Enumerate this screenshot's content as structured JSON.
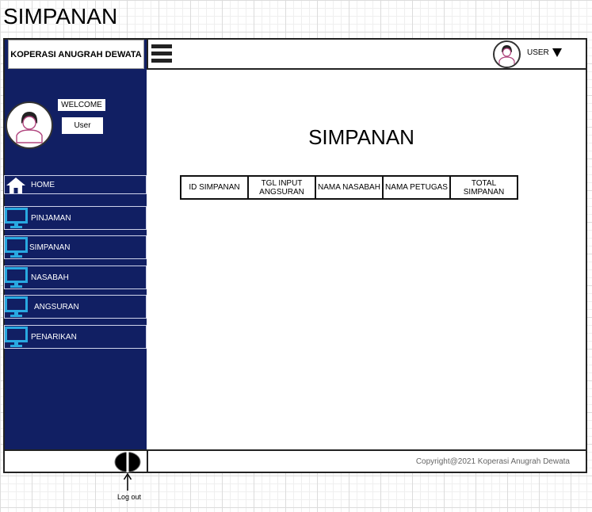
{
  "page": {
    "heading": "SIMPANAN"
  },
  "brand": {
    "name": "KOPERASI ANUGRAH DEWATA"
  },
  "topbar": {
    "user_label": "USER"
  },
  "sidebar": {
    "welcome": "WELCOME",
    "user": "User",
    "items": [
      {
        "label": "HOME",
        "icon": "home-icon"
      },
      {
        "label": "PINJAMAN",
        "icon": "monitor-icon"
      },
      {
        "label": "SIMPANAN",
        "icon": "monitor-icon"
      },
      {
        "label": "NASABAH",
        "icon": "monitor-icon"
      },
      {
        "label": "ANGSURAN",
        "icon": "monitor-icon"
      },
      {
        "label": "PENARIKAN",
        "icon": "monitor-icon"
      }
    ]
  },
  "main": {
    "title": "SIMPANAN",
    "table": {
      "columns": [
        "ID SIMPANAN",
        "TGL INPUT ANGSURAN",
        "NAMA NASABAH",
        "NAMA PETUGAS",
        "TOTAL SIMPANAN"
      ]
    }
  },
  "footer": {
    "copyright": "Copyright@2021 Koperasi Anugrah Dewata",
    "logout_label": "Log out"
  },
  "colors": {
    "sidebar_bg": "#111f63",
    "accent_icon": "#29a9e1",
    "avatar_accent": "#b0457e"
  }
}
